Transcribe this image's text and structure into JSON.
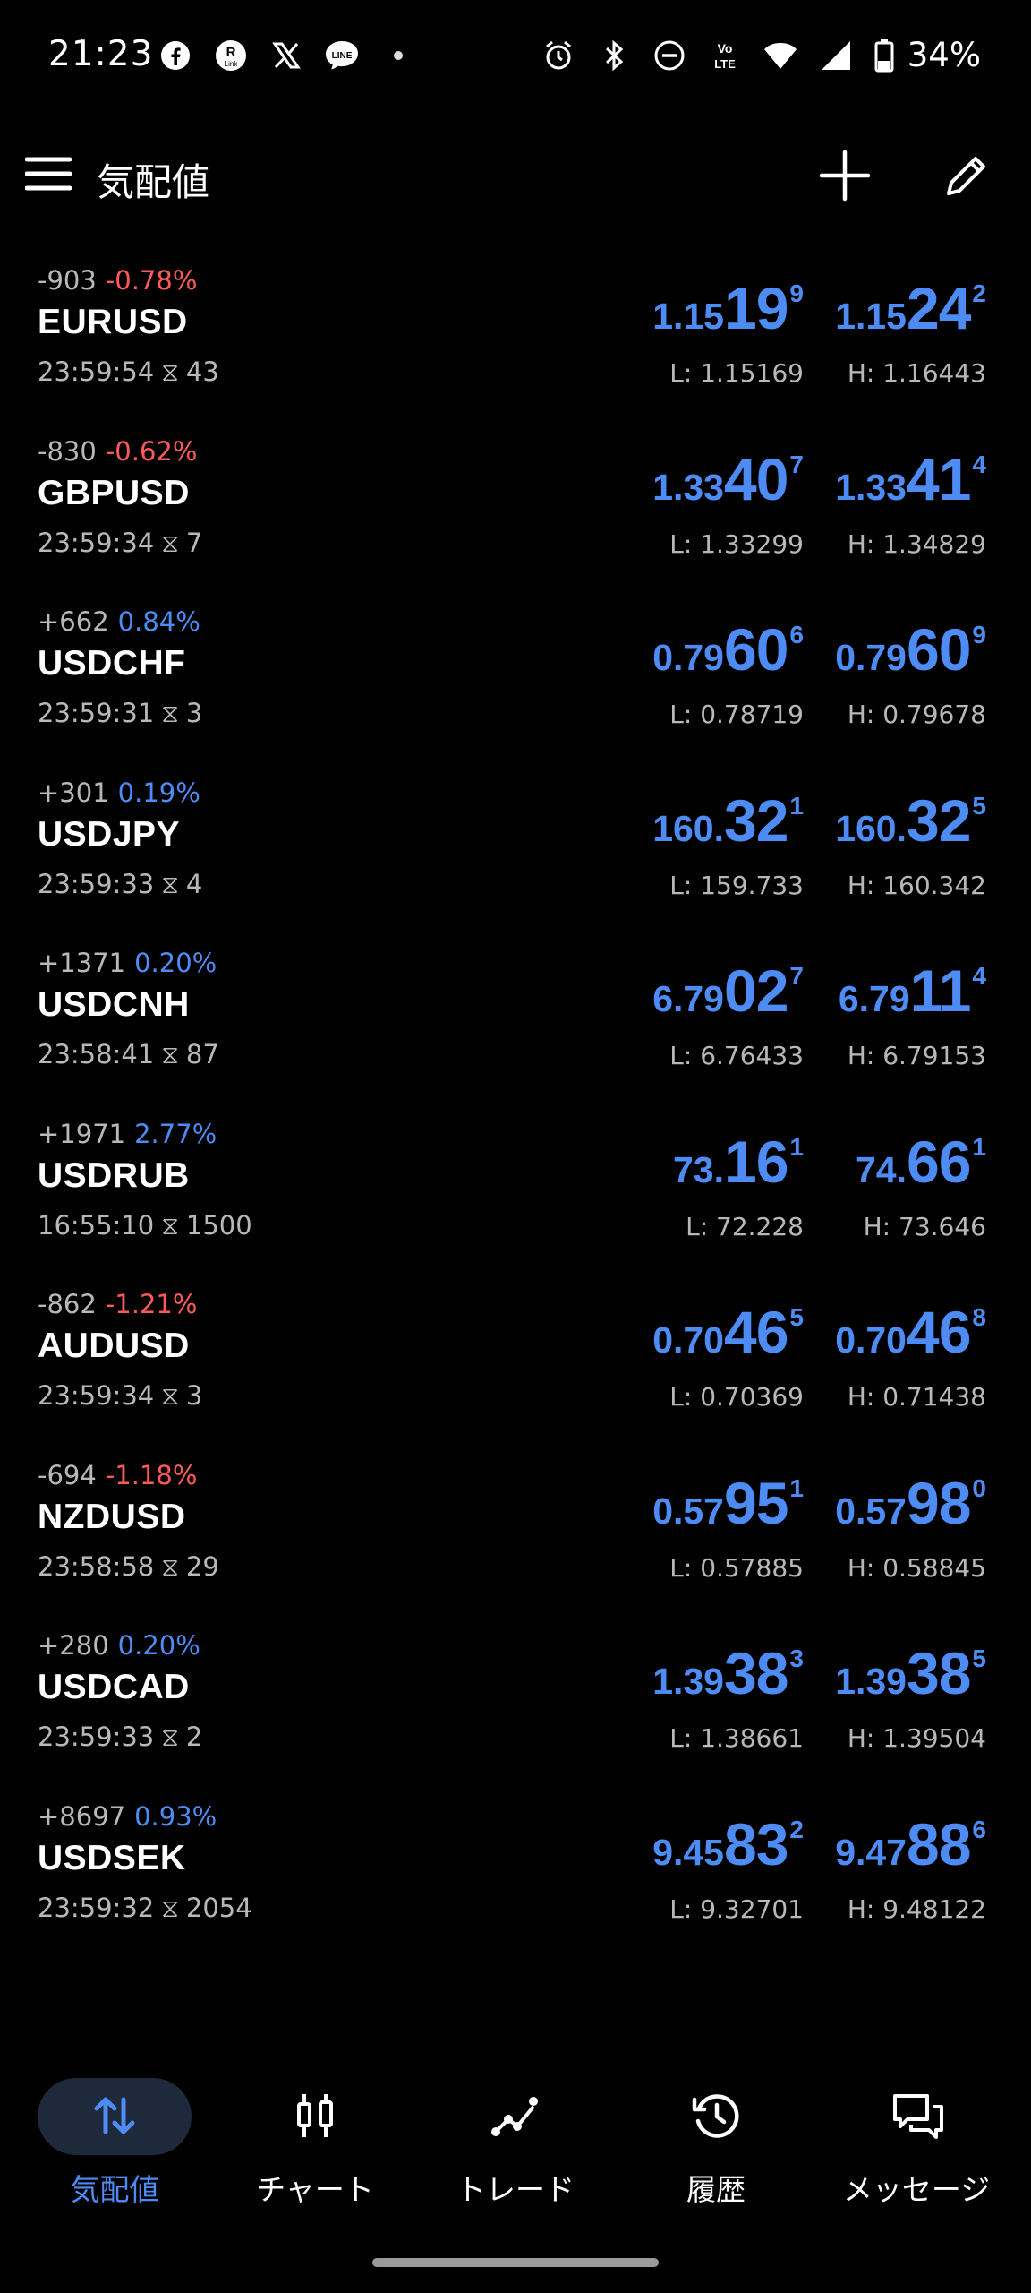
{
  "status_bar": {
    "time": "21:23",
    "battery": "34%",
    "left_icons": [
      "facebook-icon",
      "rakuten-link-icon",
      "x-icon",
      "line-icon"
    ],
    "right_icons": [
      "alarm-icon",
      "bluetooth-icon",
      "dnd-icon",
      "volte-icon",
      "wifi-icon",
      "signal-icon",
      "battery-icon"
    ]
  },
  "app_bar": {
    "title": "気配値"
  },
  "colors": {
    "accent": "#4d8cf5",
    "negative": "#ff5a5a",
    "muted": "#b8b8b8",
    "background": "#000000"
  },
  "quotes": [
    {
      "change": "-903",
      "pct": "-0.78%",
      "dir": "neg",
      "symbol": "EURUSD",
      "time": "23:59:54",
      "spread": "43",
      "bid": {
        "small": "1.15",
        "big": "19",
        "sup": "9"
      },
      "ask": {
        "small": "1.15",
        "big": "24",
        "sup": "2"
      },
      "low": "L: 1.15169",
      "high": "H: 1.16443"
    },
    {
      "change": "-830",
      "pct": "-0.62%",
      "dir": "neg",
      "symbol": "GBPUSD",
      "time": "23:59:34",
      "spread": "7",
      "bid": {
        "small": "1.33",
        "big": "40",
        "sup": "7"
      },
      "ask": {
        "small": "1.33",
        "big": "41",
        "sup": "4"
      },
      "low": "L: 1.33299",
      "high": "H: 1.34829"
    },
    {
      "change": "+662",
      "pct": "0.84%",
      "dir": "pos",
      "symbol": "USDCHF",
      "time": "23:59:31",
      "spread": "3",
      "bid": {
        "small": "0.79",
        "big": "60",
        "sup": "6"
      },
      "ask": {
        "small": "0.79",
        "big": "60",
        "sup": "9"
      },
      "low": "L: 0.78719",
      "high": "H: 0.79678"
    },
    {
      "change": "+301",
      "pct": "0.19%",
      "dir": "pos",
      "symbol": "USDJPY",
      "time": "23:59:33",
      "spread": "4",
      "bid": {
        "small": "160.",
        "big": "32",
        "sup": "1"
      },
      "ask": {
        "small": "160.",
        "big": "32",
        "sup": "5"
      },
      "low": "L: 159.733",
      "high": "H: 160.342"
    },
    {
      "change": "+1371",
      "pct": "0.20%",
      "dir": "pos",
      "symbol": "USDCNH",
      "time": "23:58:41",
      "spread": "87",
      "bid": {
        "small": "6.79",
        "big": "02",
        "sup": "7"
      },
      "ask": {
        "small": "6.79",
        "big": "11",
        "sup": "4"
      },
      "low": "L: 6.76433",
      "high": "H: 6.79153"
    },
    {
      "change": "+1971",
      "pct": "2.77%",
      "dir": "pos",
      "symbol": "USDRUB",
      "time": "16:55:10",
      "spread": "1500",
      "bid": {
        "small": "73.",
        "big": "16",
        "sup": "1"
      },
      "ask": {
        "small": "74.",
        "big": "66",
        "sup": "1"
      },
      "low": "L: 72.228",
      "high": "H: 73.646"
    },
    {
      "change": "-862",
      "pct": "-1.21%",
      "dir": "neg",
      "symbol": "AUDUSD",
      "time": "23:59:34",
      "spread": "3",
      "bid": {
        "small": "0.70",
        "big": "46",
        "sup": "5"
      },
      "ask": {
        "small": "0.70",
        "big": "46",
        "sup": "8"
      },
      "low": "L: 0.70369",
      "high": "H: 0.71438"
    },
    {
      "change": "-694",
      "pct": "-1.18%",
      "dir": "neg",
      "symbol": "NZDUSD",
      "time": "23:58:58",
      "spread": "29",
      "bid": {
        "small": "0.57",
        "big": "95",
        "sup": "1"
      },
      "ask": {
        "small": "0.57",
        "big": "98",
        "sup": "0"
      },
      "low": "L: 0.57885",
      "high": "H: 0.58845"
    },
    {
      "change": "+280",
      "pct": "0.20%",
      "dir": "pos",
      "symbol": "USDCAD",
      "time": "23:59:33",
      "spread": "2",
      "bid": {
        "small": "1.39",
        "big": "38",
        "sup": "3"
      },
      "ask": {
        "small": "1.39",
        "big": "38",
        "sup": "5"
      },
      "low": "L: 1.38661",
      "high": "H: 1.39504"
    },
    {
      "change": "+8697",
      "pct": "0.93%",
      "dir": "pos",
      "symbol": "USDSEK",
      "time": "23:59:32",
      "spread": "2054",
      "bid": {
        "small": "9.45",
        "big": "83",
        "sup": "2"
      },
      "ask": {
        "small": "9.47",
        "big": "88",
        "sup": "6"
      },
      "low": "L: 9.32701",
      "high": "H: 9.48122"
    }
  ],
  "nav": [
    {
      "label": "気配値",
      "icon": "quotes-icon",
      "active": true
    },
    {
      "label": "チャート",
      "icon": "chart-icon",
      "active": false
    },
    {
      "label": "トレード",
      "icon": "trade-icon",
      "active": false
    },
    {
      "label": "履歴",
      "icon": "history-icon",
      "active": false
    },
    {
      "label": "メッセージ",
      "icon": "messages-icon",
      "active": false
    }
  ]
}
